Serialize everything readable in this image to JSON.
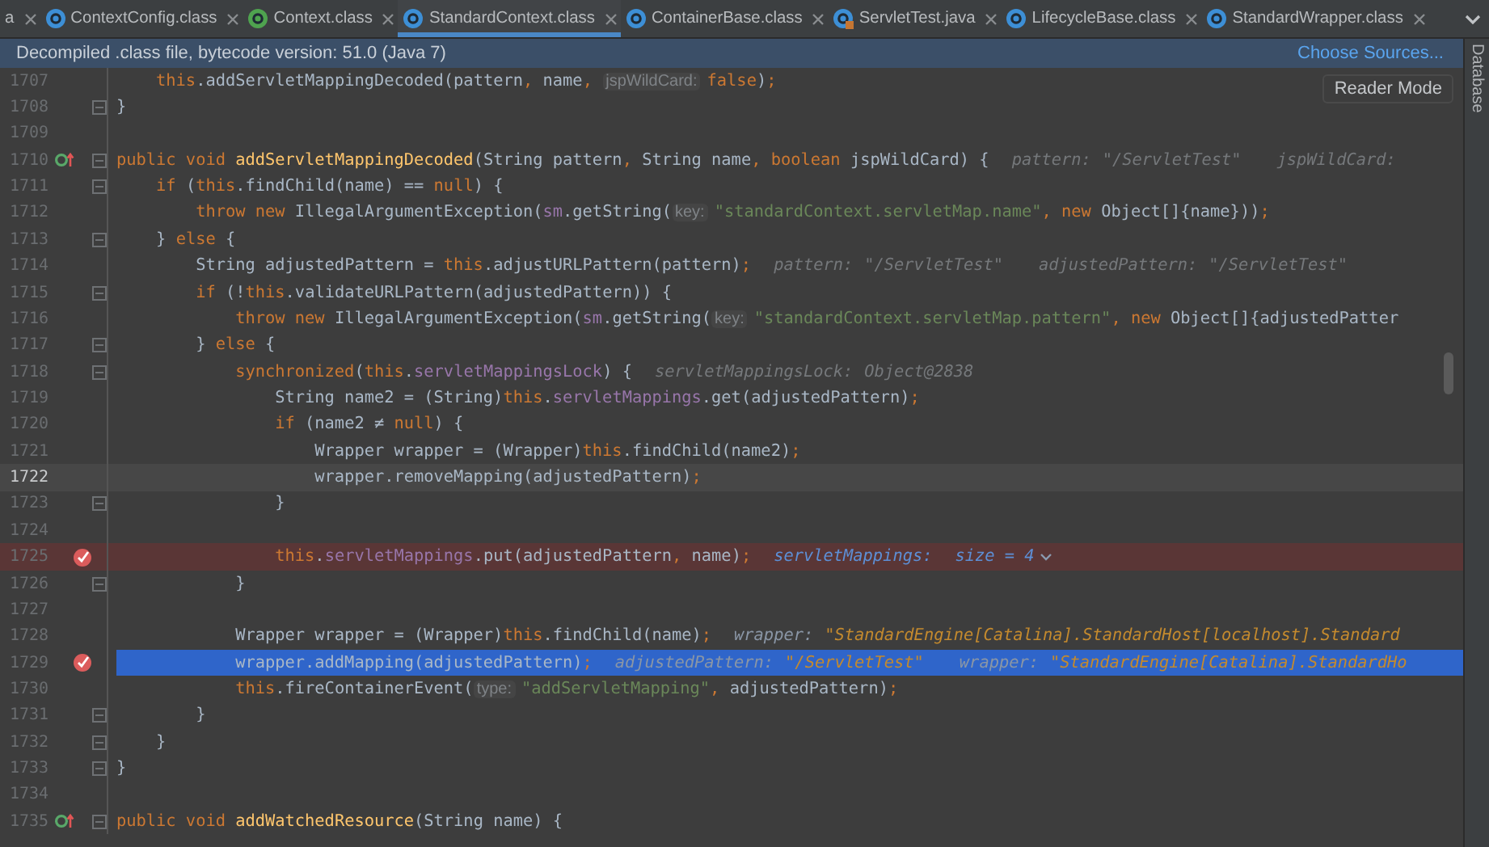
{
  "tabs": [
    {
      "label": "a",
      "kind": "plain",
      "selected": false
    },
    {
      "label": "ContextConfig.class",
      "kind": "class",
      "selected": false
    },
    {
      "label": "Context.class",
      "kind": "interface",
      "selected": false
    },
    {
      "label": "StandardContext.class",
      "kind": "class",
      "selected": true
    },
    {
      "label": "ContainerBase.class",
      "kind": "class",
      "selected": false
    },
    {
      "label": "ServletTest.java",
      "kind": "java",
      "selected": false
    },
    {
      "label": "LifecycleBase.class",
      "kind": "class",
      "selected": false
    },
    {
      "label": "StandardWrapper.class",
      "kind": "class",
      "selected": false
    }
  ],
  "banner": {
    "message": "Decompiled .class file, bytecode version: 51.0 (Java 7)",
    "link": "Choose Sources..."
  },
  "side_panel": {
    "label": "Database"
  },
  "reader_mode": {
    "label": "Reader Mode"
  },
  "lines": [
    {
      "children": [
        {
          "number": "1707",
          "kind": "plain",
          "overrides": false,
          "breakpoint": false,
          "fold": false,
          "code": [
            {
              "kind": "kw",
              "text": "this"
            },
            {
              "kind": "p",
              "text": ".addServletMappingDecoded(pattern"
            },
            {
              "kind": "c",
              "text": ", "
            },
            {
              "kind": "p",
              "text": "name"
            },
            {
              "kind": "c",
              "text": ", "
            },
            {
              "kind": "hint",
              "text": "jspWildCard:"
            },
            {
              "kind": "kw",
              "text": "false"
            },
            {
              "kind": "p",
              "text": ")"
            },
            {
              "kind": "c",
              "text": ";"
            }
          ]
        }
      ]
    },
    {
      "number": "1708",
      "kind": "plain",
      "overrides": false,
      "breakpoint": false,
      "fold": true,
      "code": [
        {
          "kind": "p",
          "text": "}"
        }
      ]
    },
    {
      "number": "1709",
      "kind": "plain",
      "overrides": false,
      "breakpoint": false,
      "fold": false
    },
    {
      "number": "1710",
      "kind": "plain",
      "overrides": true,
      "breakpoint": false,
      "fold": true,
      "code": [
        {
          "kind": "kw",
          "text": "public void "
        },
        {
          "kind": "fn",
          "text": "addServletMappingDecoded"
        },
        {
          "kind": "p",
          "text": "(String pattern"
        },
        {
          "kind": "c",
          "text": ", "
        },
        {
          "kind": "p",
          "text": "String name"
        },
        {
          "kind": "c",
          "text": ", "
        },
        {
          "kind": "kw",
          "text": "boolean "
        },
        {
          "kind": "p",
          "text": "jspWildCard) {"
        }
      ],
      "debug": [
        {
          "label": "pattern:",
          "value": "\"/ServletTest\"",
          "kind": "muted"
        },
        {
          "label": "jspWildCard:",
          "kind": "muted"
        }
      ],
      "children": [
        {
          "number": "1711",
          "kind": "plain",
          "overrides": false,
          "breakpoint": false,
          "fold": true,
          "code": [
            {
              "kind": "kw",
              "text": "if "
            },
            {
              "kind": "p",
              "text": "("
            },
            {
              "kind": "kw",
              "text": "this"
            },
            {
              "kind": "p",
              "text": ".findChild(name) == "
            },
            {
              "kind": "kw",
              "text": "null"
            },
            {
              "kind": "p",
              "text": ") {"
            }
          ],
          "children": [
            {
              "number": "1712",
              "kind": "plain",
              "overrides": false,
              "breakpoint": false,
              "fold": false,
              "code": [
                {
                  "kind": "kw",
                  "text": "throw new "
                },
                {
                  "kind": "p",
                  "text": "IllegalArgumentException("
                },
                {
                  "kind": "f",
                  "text": "sm"
                },
                {
                  "kind": "p",
                  "text": ".getString("
                },
                {
                  "kind": "hint",
                  "text": "key:"
                },
                {
                  "kind": "s",
                  "text": "\"standardContext.servletMap.name\""
                },
                {
                  "kind": "c",
                  "text": ", "
                },
                {
                  "kind": "kw",
                  "text": "new "
                },
                {
                  "kind": "p",
                  "text": "Object[]{name}))"
                },
                {
                  "kind": "c",
                  "text": ";"
                }
              ]
            }
          ]
        },
        {
          "number": "1713",
          "kind": "plain",
          "overrides": false,
          "breakpoint": false,
          "fold": true,
          "code": [
            {
              "kind": "p",
              "text": "} "
            },
            {
              "kind": "kw",
              "text": "else "
            },
            {
              "kind": "p",
              "text": "{"
            }
          ],
          "children": [
            {
              "number": "1714",
              "kind": "plain",
              "overrides": false,
              "breakpoint": false,
              "fold": false,
              "code": [
                {
                  "kind": "p",
                  "text": "String adjustedPattern = "
                },
                {
                  "kind": "kw",
                  "text": "this"
                },
                {
                  "kind": "p",
                  "text": ".adjustURLPattern(pattern)"
                },
                {
                  "kind": "c",
                  "text": ";"
                }
              ],
              "debug": [
                {
                  "label": "pattern:",
                  "value": "\"/ServletTest\"",
                  "kind": "muted"
                },
                {
                  "label": "adjustedPattern:",
                  "value": "\"/ServletTest\"",
                  "kind": "muted"
                }
              ]
            },
            {
              "number": "1715",
              "kind": "plain",
              "overrides": false,
              "breakpoint": false,
              "fold": true,
              "code": [
                {
                  "kind": "kw",
                  "text": "if "
                },
                {
                  "kind": "p",
                  "text": "(!"
                },
                {
                  "kind": "kw",
                  "text": "this"
                },
                {
                  "kind": "p",
                  "text": ".validateURLPattern(adjustedPattern)) {"
                }
              ],
              "children": [
                {
                  "number": "1716",
                  "kind": "plain",
                  "overrides": false,
                  "breakpoint": false,
                  "fold": false,
                  "code": [
                    {
                      "kind": "kw",
                      "text": "throw new "
                    },
                    {
                      "kind": "p",
                      "text": "IllegalArgumentException("
                    },
                    {
                      "kind": "f",
                      "text": "sm"
                    },
                    {
                      "kind": "p",
                      "text": ".getString("
                    },
                    {
                      "kind": "hint",
                      "text": "key:"
                    },
                    {
                      "kind": "s",
                      "text": "\"standardContext.servletMap.pattern\""
                    },
                    {
                      "kind": "c",
                      "text": ", "
                    },
                    {
                      "kind": "kw",
                      "text": "new "
                    },
                    {
                      "kind": "p",
                      "text": "Object[]{adjustedPatter"
                    }
                  ]
                }
              ]
            },
            {
              "number": "1717",
              "kind": "plain",
              "overrides": false,
              "breakpoint": false,
              "fold": true,
              "code": [
                {
                  "kind": "p",
                  "text": "} "
                },
                {
                  "kind": "kw",
                  "text": "else "
                },
                {
                  "kind": "p",
                  "text": "{"
                }
              ],
              "children": [
                {
                  "number": "1718",
                  "kind": "plain",
                  "overrides": false,
                  "breakpoint": false,
                  "fold": true,
                  "code": [
                    {
                      "kind": "kw",
                      "text": "synchronized"
                    },
                    {
                      "kind": "p",
                      "text": "("
                    },
                    {
                      "kind": "kw",
                      "text": "this"
                    },
                    {
                      "kind": "p",
                      "text": "."
                    },
                    {
                      "kind": "f",
                      "text": "servletMappingsLock"
                    },
                    {
                      "kind": "p",
                      "text": ") {"
                    }
                  ],
                  "debug": [
                    {
                      "label": "servletMappingsLock:",
                      "value": "Object@2838",
                      "kind": "muted"
                    }
                  ],
                  "children": [
                    {
                      "number": "1719",
                      "kind": "plain",
                      "overrides": false,
                      "breakpoint": false,
                      "fold": false,
                      "code": [
                        {
                          "kind": "p",
                          "text": "String name2 = (String)"
                        },
                        {
                          "kind": "kw",
                          "text": "this"
                        },
                        {
                          "kind": "p",
                          "text": "."
                        },
                        {
                          "kind": "f",
                          "text": "servletMappings"
                        },
                        {
                          "kind": "p",
                          "text": ".get(adjustedPattern)"
                        },
                        {
                          "kind": "c",
                          "text": ";"
                        }
                      ]
                    },
                    {
                      "number": "1720",
                      "kind": "plain",
                      "overrides": false,
                      "breakpoint": false,
                      "fold": false,
                      "code": [
                        {
                          "kind": "kw",
                          "text": "if "
                        },
                        {
                          "kind": "p",
                          "text": "(name2 ≠ "
                        },
                        {
                          "kind": "kw",
                          "text": "null"
                        },
                        {
                          "kind": "p",
                          "text": ") {"
                        }
                      ],
                      "children": [
                        {
                          "number": "1721",
                          "kind": "plain",
                          "overrides": false,
                          "breakpoint": false,
                          "fold": false,
                          "code": [
                            {
                              "kind": "p",
                              "text": "Wrapper wrapper = (Wrapper)"
                            },
                            {
                              "kind": "kw",
                              "text": "this"
                            },
                            {
                              "kind": "p",
                              "text": ".findChild(name2)"
                            },
                            {
                              "kind": "c",
                              "text": ";"
                            }
                          ]
                        },
                        {
                          "number": "1722",
                          "kind": "caret",
                          "overrides": false,
                          "breakpoint": false,
                          "fold": false,
                          "code": [
                            {
                              "kind": "p",
                              "text": "wrapper.removeMapping(adjustedPattern)"
                            },
                            {
                              "kind": "c",
                              "text": ";"
                            }
                          ]
                        }
                      ]
                    },
                    {
                      "number": "1723",
                      "kind": "plain",
                      "overrides": false,
                      "breakpoint": false,
                      "fold": true,
                      "code": [
                        {
                          "kind": "p",
                          "text": "}"
                        }
                      ]
                    },
                    {
                      "number": "1724",
                      "kind": "plain",
                      "overrides": false,
                      "breakpoint": false,
                      "fold": false
                    },
                    {
                      "number": "1725",
                      "kind": "breakpoint",
                      "overrides": false,
                      "breakpoint": true,
                      "fold": false,
                      "code": [
                        {
                          "kind": "kw",
                          "text": "this"
                        },
                        {
                          "kind": "p",
                          "text": "."
                        },
                        {
                          "kind": "f",
                          "text": "servletMappings"
                        },
                        {
                          "kind": "p",
                          "text": ".put(adjustedPattern"
                        },
                        {
                          "kind": "c",
                          "text": ", "
                        },
                        {
                          "kind": "p",
                          "text": "name)"
                        },
                        {
                          "kind": "c",
                          "text": ";"
                        }
                      ],
                      "debug": [
                        {
                          "label": "servletMappings:",
                          "value": "size = 4",
                          "kind": "collection"
                        }
                      ]
                    }
                  ]
                },
                {
                  "number": "1726",
                  "kind": "plain",
                  "overrides": false,
                  "breakpoint": false,
                  "fold": true,
                  "code": [
                    {
                      "kind": "p",
                      "text": "}"
                    }
                  ]
                },
                {
                  "number": "1727",
                  "kind": "plain",
                  "overrides": false,
                  "breakpoint": false,
                  "fold": false
                },
                {
                  "number": "1728",
                  "kind": "plain",
                  "overrides": false,
                  "breakpoint": false,
                  "fold": false,
                  "code": [
                    {
                      "kind": "p",
                      "text": "Wrapper wrapper = (Wrapper)"
                    },
                    {
                      "kind": "kw",
                      "text": "this"
                    },
                    {
                      "kind": "p",
                      "text": ".findChild(name)"
                    },
                    {
                      "kind": "c",
                      "text": ";"
                    }
                  ],
                  "debug": [
                    {
                      "label": "wrapper:",
                      "value": "\"StandardEngine[Catalina].StandardHost[localhost].Standard",
                      "kind": "string"
                    }
                  ]
                },
                {
                  "number": "1729",
                  "kind": "execution",
                  "overrides": false,
                  "breakpoint": true,
                  "fold": false,
                  "code": [
                    {
                      "kind": "p",
                      "text": "wrapper.addMapping(adjustedPattern)"
                    },
                    {
                      "kind": "c",
                      "text": ";"
                    }
                  ],
                  "debug": [
                    {
                      "label": "adjustedPattern:",
                      "value": "\"/ServletTest\"",
                      "kind": "string"
                    },
                    {
                      "label": "wrapper:",
                      "value": "\"StandardEngine[Catalina].StandardHo",
                      "kind": "string"
                    }
                  ]
                },
                {
                  "number": "1730",
                  "kind": "plain",
                  "overrides": false,
                  "breakpoint": false,
                  "fold": false,
                  "code": [
                    {
                      "kind": "kw",
                      "text": "this"
                    },
                    {
                      "kind": "p",
                      "text": ".fireContainerEvent("
                    },
                    {
                      "kind": "hint",
                      "text": "type:"
                    },
                    {
                      "kind": "s",
                      "text": "\"addServletMapping\""
                    },
                    {
                      "kind": "c",
                      "text": ", "
                    },
                    {
                      "kind": "p",
                      "text": "adjustedPattern)"
                    },
                    {
                      "kind": "c",
                      "text": ";"
                    }
                  ]
                }
              ]
            },
            {
              "number": "1731",
              "kind": "plain",
              "overrides": false,
              "breakpoint": false,
              "fold": true,
              "code": [
                {
                  "kind": "p",
                  "text": "}"
                }
              ]
            }
          ]
        },
        {
          "number": "1732",
          "kind": "plain",
          "overrides": false,
          "breakpoint": false,
          "fold": true,
          "code": [
            {
              "kind": "p",
              "text": "}"
            }
          ]
        }
      ]
    },
    {
      "number": "1733",
      "kind": "plain",
      "overrides": false,
      "breakpoint": false,
      "fold": true,
      "code": [
        {
          "kind": "p",
          "text": "}"
        }
      ]
    },
    {
      "number": "1734",
      "kind": "plain",
      "overrides": false,
      "breakpoint": false,
      "fold": false
    },
    {
      "number": "1735",
      "kind": "plain",
      "overrides": true,
      "breakpoint": false,
      "fold": true,
      "code": [
        {
          "kind": "kw",
          "text": "public void "
        },
        {
          "kind": "fn",
          "text": "addWatchedResource"
        },
        {
          "kind": "p",
          "text": "(String name) {"
        }
      ]
    }
  ]
}
